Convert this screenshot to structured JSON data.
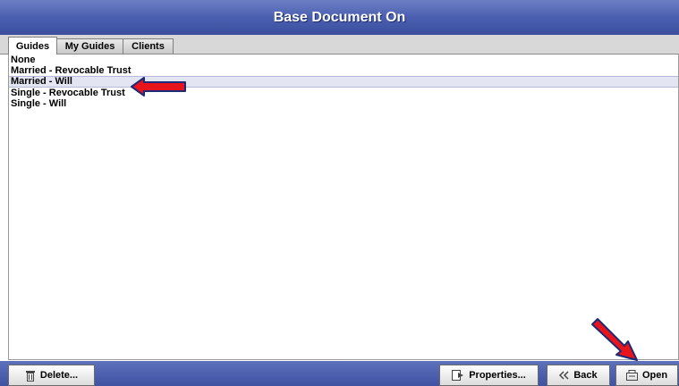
{
  "window": {
    "title": "Base Document On"
  },
  "tabs": [
    {
      "label": "Guides",
      "active": true
    },
    {
      "label": "My Guides",
      "active": false
    },
    {
      "label": "Clients",
      "active": false
    }
  ],
  "list": {
    "items": [
      {
        "label": "None"
      },
      {
        "label": "Married - Revocable Trust"
      },
      {
        "label": "Married - Will",
        "selected": true
      },
      {
        "label": "Single - Revocable Trust"
      },
      {
        "label": "Single - Will"
      }
    ]
  },
  "buttons": {
    "delete": "Delete...",
    "properties": "Properties...",
    "back": "Back",
    "open": "Open"
  },
  "colors": {
    "title_bar": "#4a5fb0",
    "selection": "#e3e5f3",
    "annotation_arrow": "#e8141b"
  }
}
